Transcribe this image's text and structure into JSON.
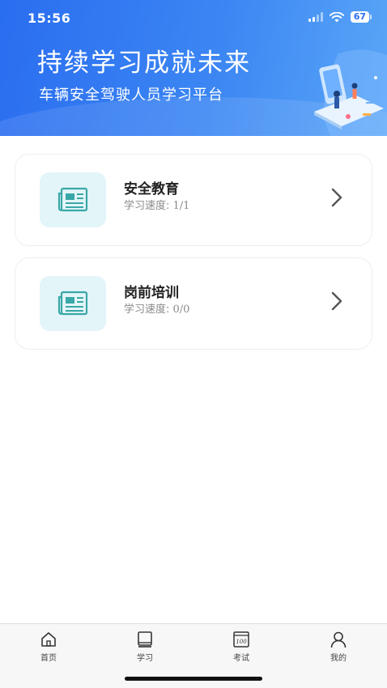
{
  "status_bar": {
    "time": "15:56",
    "battery": "67"
  },
  "header": {
    "title": "持续学习成就未来",
    "subtitle": "车辆安全驾驶人员学习平台"
  },
  "courses": [
    {
      "title": "安全教育",
      "progress_label": "学习速度:",
      "progress_value": "1/1"
    },
    {
      "title": "岗前培训",
      "progress_label": "学习速度:",
      "progress_value": "0/0"
    }
  ],
  "tabbar": {
    "items": [
      {
        "label": "首页",
        "icon": "home-icon"
      },
      {
        "label": "学习",
        "icon": "book-icon"
      },
      {
        "label": "考试",
        "icon": "exam-icon"
      },
      {
        "label": "我的",
        "icon": "user-icon"
      }
    ],
    "active_index": 1
  },
  "colors": {
    "header_start": "#2a6df0",
    "header_end": "#5aa6f7",
    "icon_bg": "#e3f5f8",
    "icon_teal": "#3aa7a7"
  }
}
